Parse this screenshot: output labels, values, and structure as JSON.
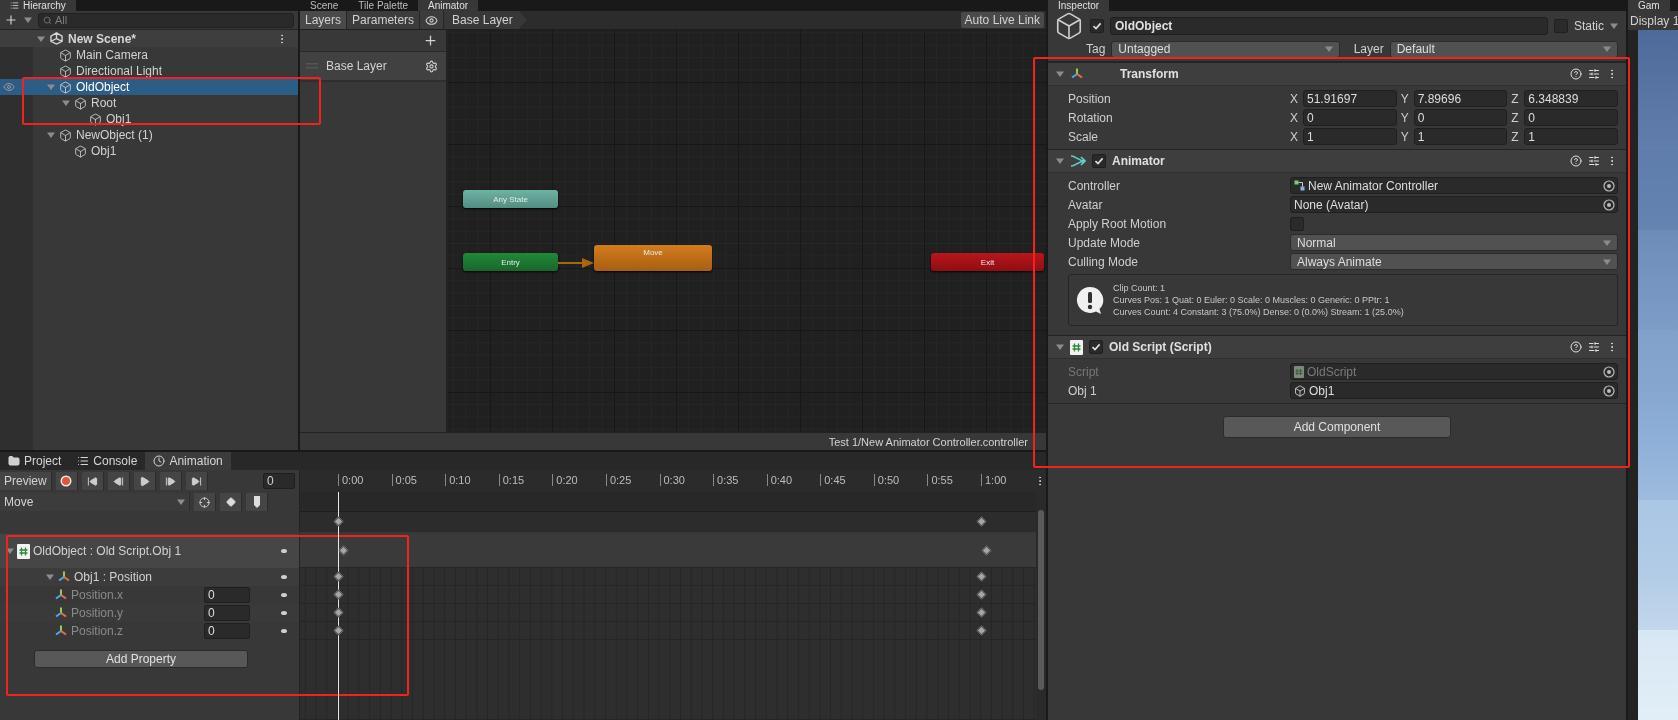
{
  "hierarchy": {
    "tab": "Hierarchy",
    "search_placeholder": "All",
    "scene": {
      "name": "New Scene*",
      "expanded": true
    },
    "items": [
      {
        "name": "Main Camera",
        "selected": false
      },
      {
        "name": "Directional Light",
        "selected": false
      },
      {
        "name": "OldObject",
        "selected": true,
        "expanded": true,
        "children": [
          {
            "name": "Root",
            "selected": false,
            "expanded": true,
            "children": [
              {
                "name": "Obj1",
                "selected": false
              }
            ]
          }
        ]
      },
      {
        "name": "NewObject (1)",
        "selected": false,
        "expanded": true,
        "children": [
          {
            "name": "Obj1",
            "selected": false
          }
        ]
      }
    ]
  },
  "center_tabs": [
    {
      "label": "Scene",
      "selected": false
    },
    {
      "label": "Tile Palette",
      "selected": false
    },
    {
      "label": "Animator",
      "selected": true
    }
  ],
  "animator": {
    "toolbar": [
      {
        "label": "Layers",
        "selected": true
      },
      {
        "label": "Parameters",
        "selected": false
      }
    ],
    "breadcrumb": "Base Layer",
    "auto_live_link": "Auto Live Link",
    "layers": [
      "Base Layer"
    ],
    "states": [
      {
        "name": "Any State",
        "kind": "any"
      },
      {
        "name": "Entry",
        "kind": "entry"
      },
      {
        "name": "Move",
        "kind": "default"
      },
      {
        "name": "Exit",
        "kind": "exit"
      }
    ],
    "status": "Test 1/New Animator Controller.controller"
  },
  "inspector": {
    "tab": "Inspector",
    "object": {
      "active": true,
      "name": "OldObject",
      "static": false,
      "static_label": "Static"
    },
    "tag_label": "Tag",
    "tag": "Untagged",
    "layer_label": "Layer",
    "layer": "Default",
    "components": [
      {
        "kind": "transform",
        "title": "Transform",
        "rows": [
          {
            "label": "Position",
            "values": [
              {
                "axis": "X",
                "value": "51.91697"
              },
              {
                "axis": "Y",
                "value": "7.89696"
              },
              {
                "axis": "Z",
                "value": "6.348839"
              }
            ]
          },
          {
            "label": "Rotation",
            "values": [
              {
                "axis": "X",
                "value": "0"
              },
              {
                "axis": "Y",
                "value": "0"
              },
              {
                "axis": "Z",
                "value": "0"
              }
            ]
          },
          {
            "label": "Scale",
            "values": [
              {
                "axis": "X",
                "value": "1"
              },
              {
                "axis": "Y",
                "value": "1"
              },
              {
                "axis": "Z",
                "value": "1"
              }
            ]
          }
        ]
      },
      {
        "kind": "animator",
        "title": "Animator",
        "enabled": true,
        "fields": [
          {
            "kind": "controller",
            "label": "Controller",
            "value": "New Animator Controller"
          },
          {
            "kind": "object",
            "label": "Avatar",
            "value": "None (Avatar)"
          },
          {
            "kind": "checkbox",
            "label": "Apply Root Motion",
            "checked": false
          },
          {
            "kind": "dropdown",
            "label": "Update Mode",
            "value": "Normal"
          },
          {
            "kind": "dropdown",
            "label": "Culling Mode",
            "value": "Always Animate"
          }
        ],
        "info": [
          "Clip Count: 1",
          "Curves Pos: 1 Quat: 0 Euler: 0 Scale: 0 Muscles: 0 Generic: 0 PPtr: 1",
          "Curves Count: 4 Constant: 3 (75.0%) Dense: 0 (0.0%) Stream: 1 (25.0%)"
        ]
      },
      {
        "kind": "script",
        "title": "Old Script (Script)",
        "enabled": true,
        "fields": [
          {
            "kind": "script",
            "label": "Script",
            "value": "OldScript",
            "disabled": true
          },
          {
            "kind": "gameobject",
            "label": "Obj 1",
            "value": "Obj1",
            "disabled": false
          }
        ]
      }
    ],
    "add_component": "Add Component"
  },
  "game": {
    "tab": "Gam",
    "display": "Display 1"
  },
  "bottom_tabs": [
    {
      "label": "Project",
      "kind": "project",
      "selected": false
    },
    {
      "label": "Console",
      "kind": "console",
      "selected": false
    },
    {
      "label": "Animation",
      "kind": "animation",
      "selected": true
    }
  ],
  "animation": {
    "preview": "Preview",
    "frame": "0",
    "clip": "Move",
    "ticks": [
      "0:00",
      "0:05",
      "0:10",
      "0:15",
      "0:20",
      "0:25",
      "0:30",
      "0:35",
      "0:40",
      "0:45",
      "0:50",
      "0:55",
      "1:00"
    ],
    "tracks": [
      {
        "kind": "group",
        "label": "OldObject : Old Script.Obj 1",
        "expanded": true,
        "children": [
          {
            "kind": "group",
            "label": "Obj1 : Position",
            "expanded": true,
            "children": [
              {
                "kind": "property",
                "label": "Position.x",
                "value": "0"
              },
              {
                "kind": "property",
                "label": "Position.y",
                "value": "0"
              },
              {
                "kind": "property",
                "label": "Position.z",
                "value": "0"
              }
            ]
          }
        ]
      }
    ],
    "add_property": "Add Property"
  },
  "annotations": [
    {
      "kind": "hierarchy"
    },
    {
      "kind": "inspector"
    },
    {
      "kind": "animation"
    }
  ]
}
